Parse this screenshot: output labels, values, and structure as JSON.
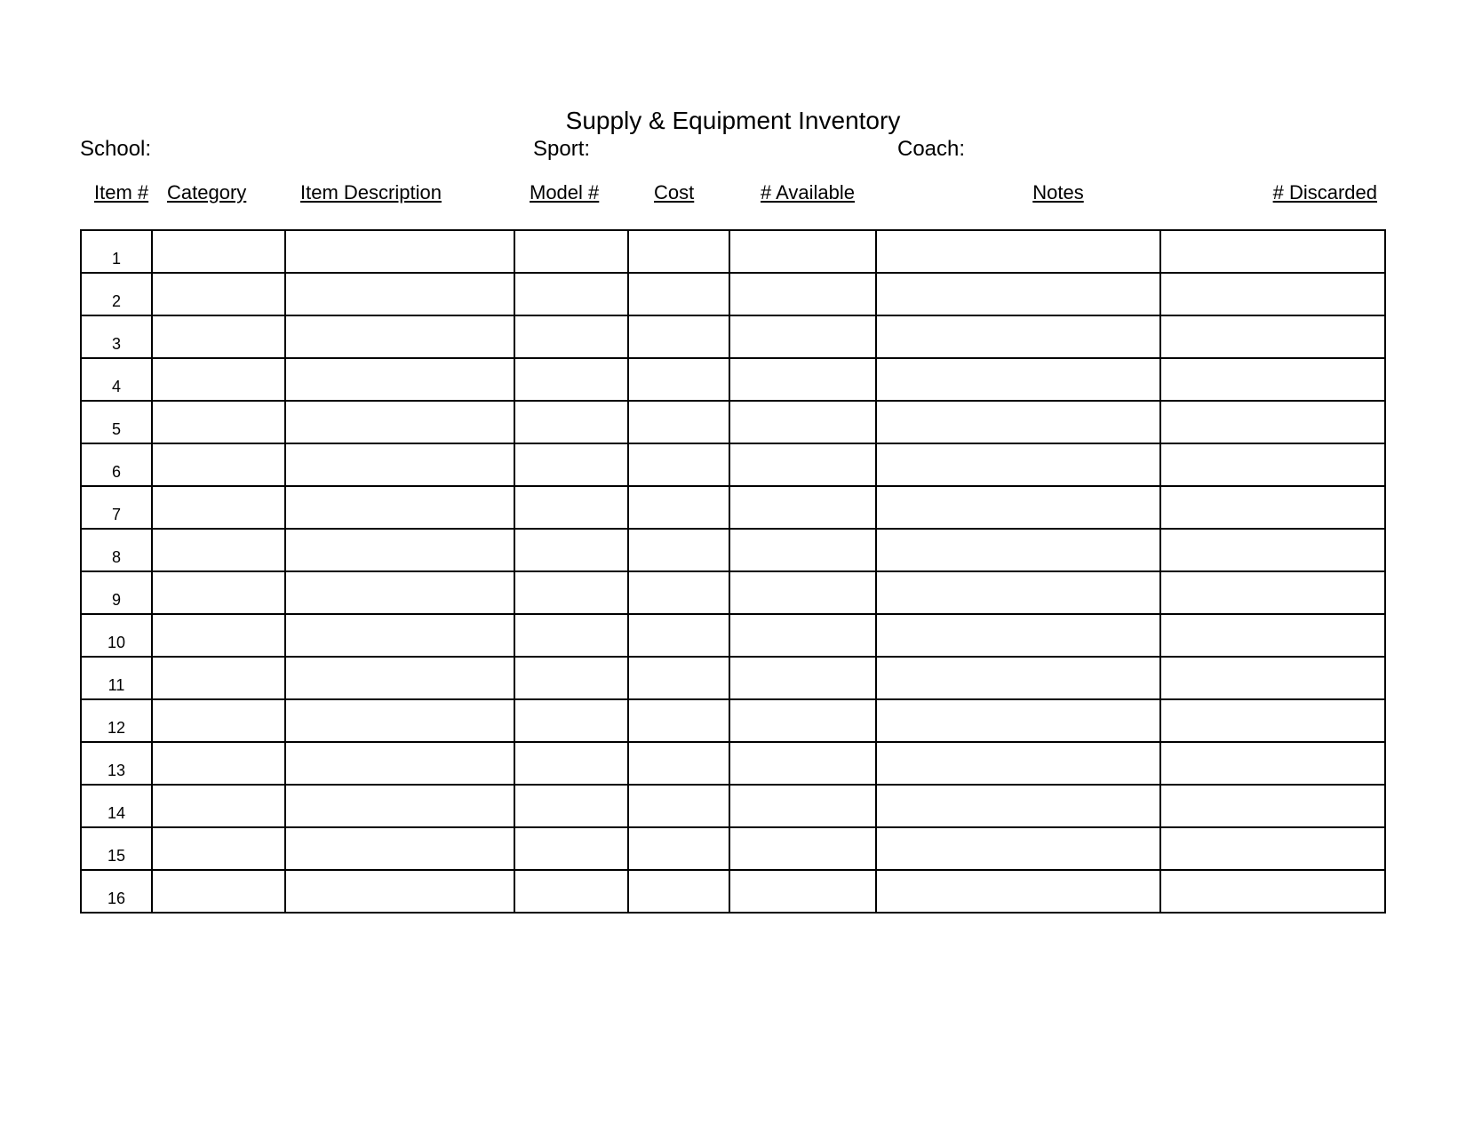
{
  "title": "Supply & Equipment Inventory",
  "meta": {
    "school_label": "School:",
    "sport_label": "Sport:",
    "coach_label": "Coach:",
    "school_value": "",
    "sport_value": "",
    "coach_value": ""
  },
  "columns": {
    "item_no": "Item #",
    "category": "Category",
    "description": "Item Description",
    "model_no": "Model #",
    "cost": "Cost",
    "available": "# Available",
    "notes": "Notes",
    "discarded": "# Discarded"
  },
  "rows": [
    {
      "n": "1",
      "category": "",
      "description": "",
      "model": "",
      "cost": "",
      "available": "",
      "notes": "",
      "discarded": ""
    },
    {
      "n": "2",
      "category": "",
      "description": "",
      "model": "",
      "cost": "",
      "available": "",
      "notes": "",
      "discarded": ""
    },
    {
      "n": "3",
      "category": "",
      "description": "",
      "model": "",
      "cost": "",
      "available": "",
      "notes": "",
      "discarded": ""
    },
    {
      "n": "4",
      "category": "",
      "description": "",
      "model": "",
      "cost": "",
      "available": "",
      "notes": "",
      "discarded": ""
    },
    {
      "n": "5",
      "category": "",
      "description": "",
      "model": "",
      "cost": "",
      "available": "",
      "notes": "",
      "discarded": ""
    },
    {
      "n": "6",
      "category": "",
      "description": "",
      "model": "",
      "cost": "",
      "available": "",
      "notes": "",
      "discarded": ""
    },
    {
      "n": "7",
      "category": "",
      "description": "",
      "model": "",
      "cost": "",
      "available": "",
      "notes": "",
      "discarded": ""
    },
    {
      "n": "8",
      "category": "",
      "description": "",
      "model": "",
      "cost": "",
      "available": "",
      "notes": "",
      "discarded": ""
    },
    {
      "n": "9",
      "category": "",
      "description": "",
      "model": "",
      "cost": "",
      "available": "",
      "notes": "",
      "discarded": ""
    },
    {
      "n": "10",
      "category": "",
      "description": "",
      "model": "",
      "cost": "",
      "available": "",
      "notes": "",
      "discarded": ""
    },
    {
      "n": "11",
      "category": "",
      "description": "",
      "model": "",
      "cost": "",
      "available": "",
      "notes": "",
      "discarded": ""
    },
    {
      "n": "12",
      "category": "",
      "description": "",
      "model": "",
      "cost": "",
      "available": "",
      "notes": "",
      "discarded": ""
    },
    {
      "n": "13",
      "category": "",
      "description": "",
      "model": "",
      "cost": "",
      "available": "",
      "notes": "",
      "discarded": ""
    },
    {
      "n": "14",
      "category": "",
      "description": "",
      "model": "",
      "cost": "",
      "available": "",
      "notes": "",
      "discarded": ""
    },
    {
      "n": "15",
      "category": "",
      "description": "",
      "model": "",
      "cost": "",
      "available": "",
      "notes": "",
      "discarded": ""
    },
    {
      "n": "16",
      "category": "",
      "description": "",
      "model": "",
      "cost": "",
      "available": "",
      "notes": "",
      "discarded": ""
    }
  ]
}
